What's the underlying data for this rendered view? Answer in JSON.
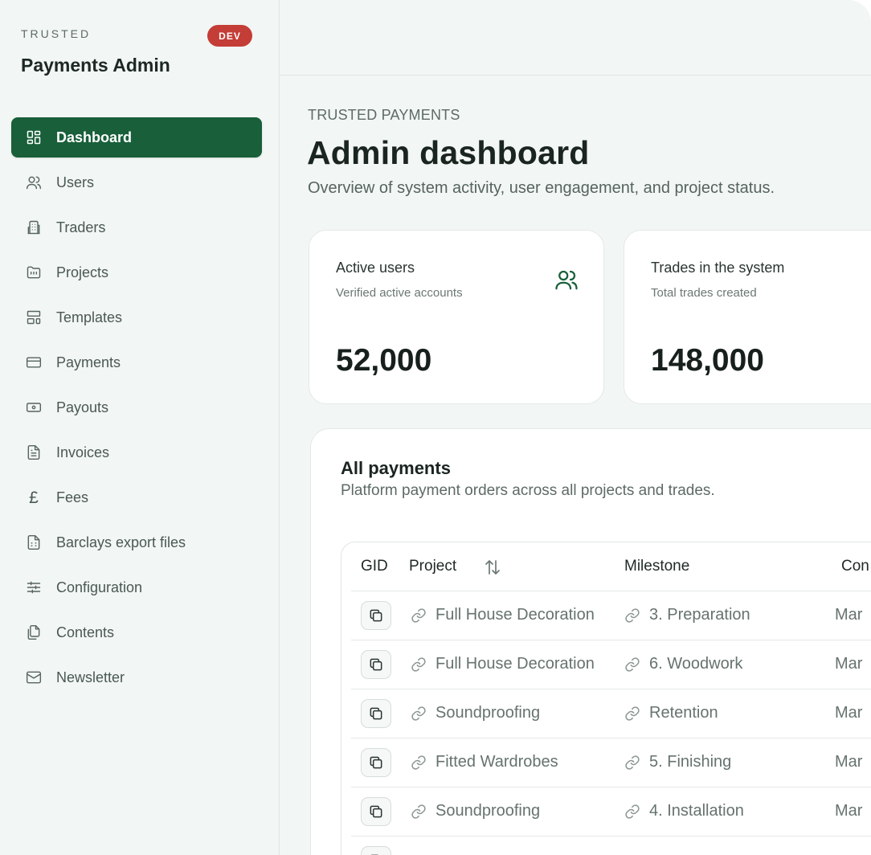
{
  "sidebar": {
    "kicker": "TRUSTED",
    "env_badge": "DEV",
    "title": "Payments Admin",
    "items": [
      {
        "label": "Dashboard",
        "icon": "dashboard-grid-icon",
        "active": true
      },
      {
        "label": "Users",
        "icon": "users-icon"
      },
      {
        "label": "Traders",
        "icon": "building-icon"
      },
      {
        "label": "Projects",
        "icon": "folder-icon"
      },
      {
        "label": "Templates",
        "icon": "layout-template-icon"
      },
      {
        "label": "Payments",
        "icon": "credit-card-icon"
      },
      {
        "label": "Payouts",
        "icon": "banknote-icon"
      },
      {
        "label": "Invoices",
        "icon": "file-text-icon"
      },
      {
        "label": "Fees",
        "icon": "pound-sign-icon",
        "glyph": "£"
      },
      {
        "label": "Barclays export files",
        "icon": "file-spreadsheet-icon"
      },
      {
        "label": "Configuration",
        "icon": "sliders-icon"
      },
      {
        "label": "Contents",
        "icon": "files-icon"
      },
      {
        "label": "Newsletter",
        "icon": "mail-icon"
      }
    ]
  },
  "header": {
    "kicker": "TRUSTED PAYMENTS",
    "title": "Admin dashboard",
    "subtitle": "Overview of system activity, user engagement, and project status."
  },
  "stats": [
    {
      "label": "Active users",
      "description": "Verified active accounts",
      "value": "52,000",
      "icon": "users-icon"
    },
    {
      "label": "Trades in the system",
      "description": "Total trades created",
      "value": "148,000"
    }
  ],
  "payments": {
    "title": "All payments",
    "subtitle": "Platform payment orders across all projects and trades.",
    "columns": [
      "GID",
      "Project",
      "Milestone",
      "Con"
    ],
    "rows": [
      {
        "project": "Full House Decoration",
        "milestone": "3. Preparation",
        "next": "Mar"
      },
      {
        "project": "Full House Decoration",
        "milestone": "6. Woodwork",
        "next": "Mar"
      },
      {
        "project": "Soundproofing",
        "milestone": "Retention",
        "next": "Mar"
      },
      {
        "project": "Fitted Wardrobes",
        "milestone": "5. Finishing",
        "next": "Mar"
      },
      {
        "project": "Soundproofing",
        "milestone": "4. Installation",
        "next": "Mar"
      }
    ]
  },
  "colors": {
    "accent": "#185f3a",
    "badge": "#c43d36",
    "background": "#f2f6f4"
  }
}
